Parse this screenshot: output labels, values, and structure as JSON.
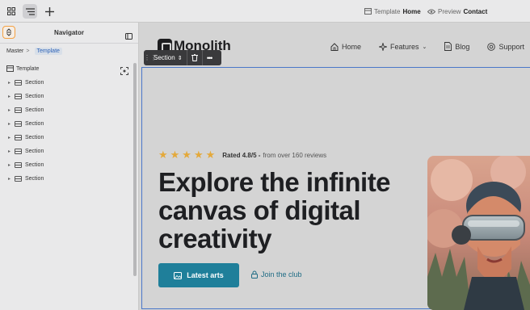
{
  "topbar": {
    "template_prefix": "Template",
    "template_name": "Home",
    "preview_prefix": "Preview",
    "preview_name": "Contact"
  },
  "navigator": {
    "title": "Navigator",
    "breadcrumb": {
      "root": "Master",
      "current": "Template"
    },
    "tree_root": "Template",
    "items": [
      {
        "label": "Section"
      },
      {
        "label": "Section"
      },
      {
        "label": "Section"
      },
      {
        "label": "Section"
      },
      {
        "label": "Section"
      },
      {
        "label": "Section"
      },
      {
        "label": "Section"
      },
      {
        "label": "Section"
      }
    ]
  },
  "site": {
    "logo_text": "Monolith",
    "menu": {
      "home": "Home",
      "features": "Features",
      "blog": "Blog",
      "support": "Support"
    }
  },
  "section_toolbar": {
    "label": "Section"
  },
  "hero": {
    "stars": "★★★★★",
    "rating_bold": "Rated 4.8/5 -",
    "rating_rest": "from over 160 reviews",
    "headline_line1": "Explore the infinite",
    "headline_line2": "canvas of digital",
    "headline_line3": "creativity",
    "cta_label": "Latest arts",
    "join_label": "Join the club"
  },
  "colors": {
    "accent": "#1f7f9a",
    "selection": "#4a77c9",
    "star": "#e4a93b",
    "highlight": "#f5a142"
  }
}
